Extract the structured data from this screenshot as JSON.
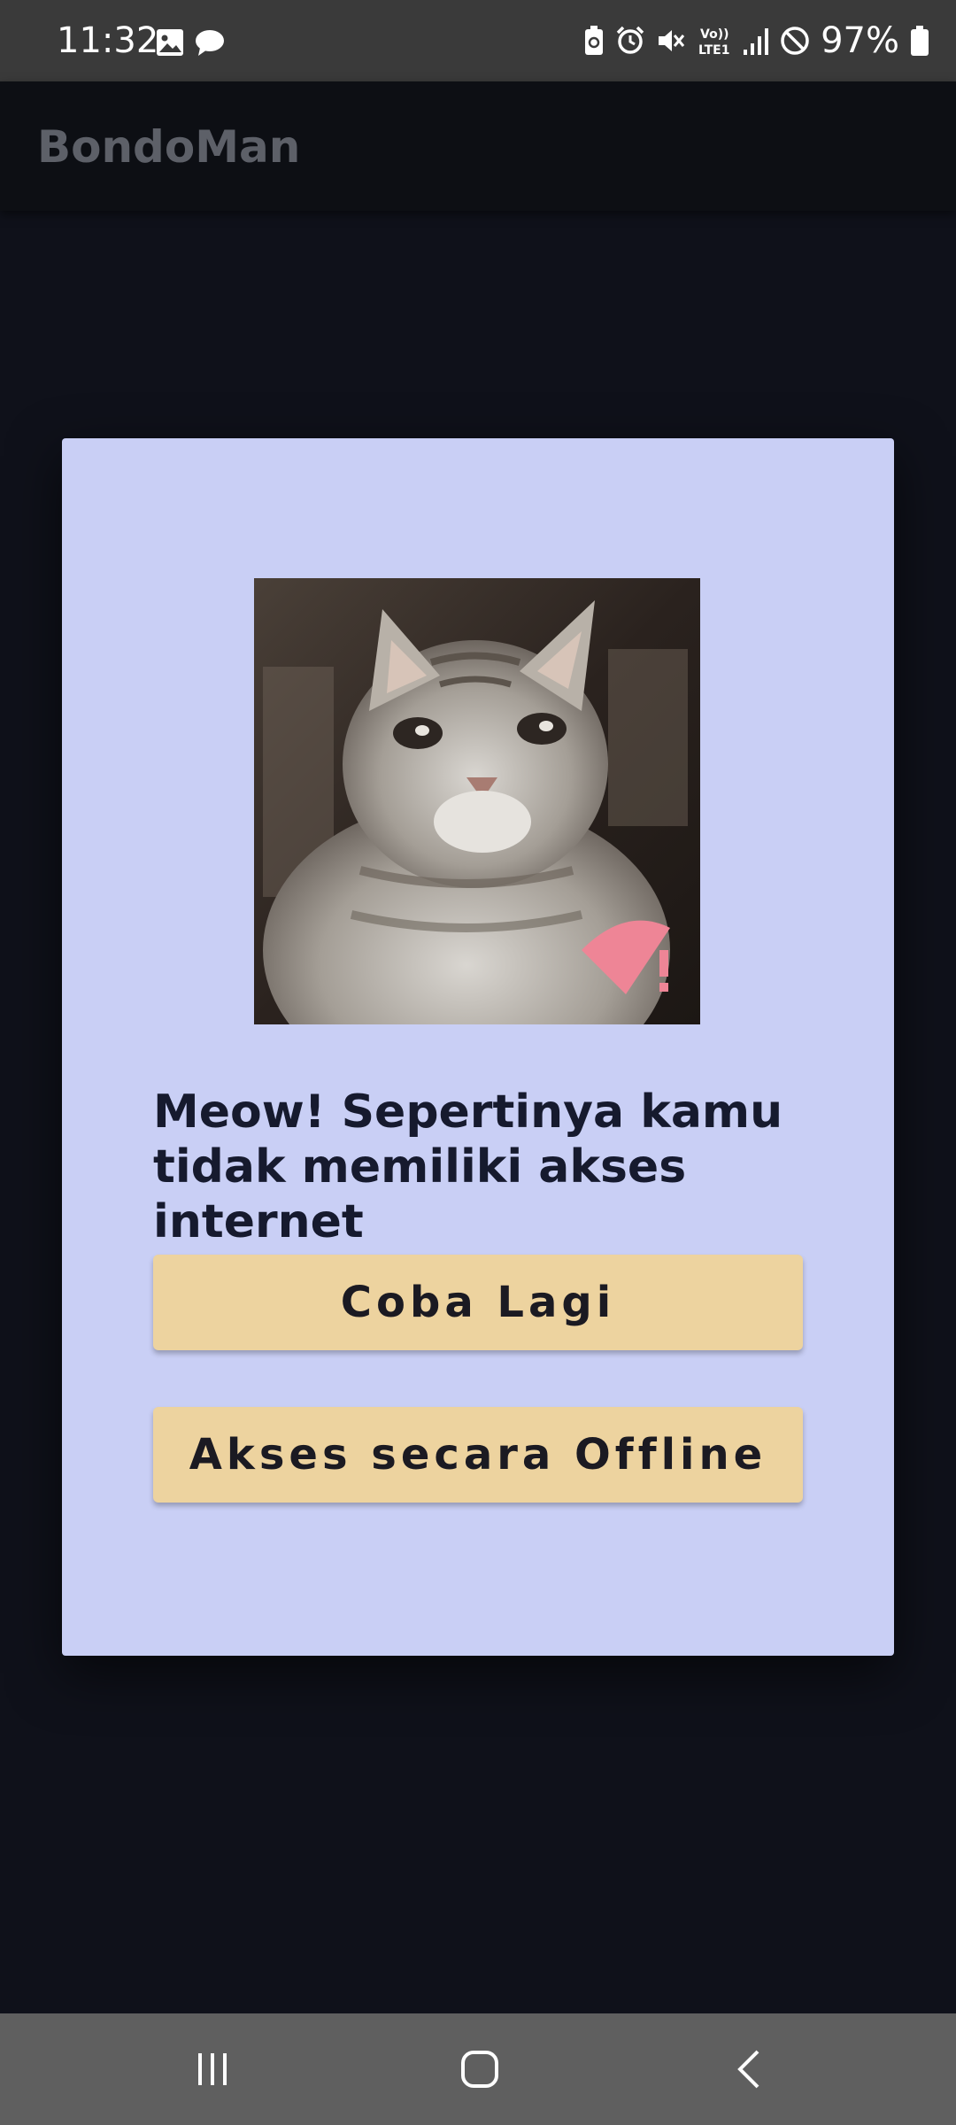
{
  "status_bar": {
    "time": "11:32",
    "battery_percent": "97%",
    "left_icons": [
      "image-icon",
      "chat-bubble-icon"
    ],
    "right_icons": [
      "battery-saver-icon",
      "alarm-icon",
      "mute-icon",
      "volte-icon",
      "signal-icon",
      "do-not-disturb-icon",
      "battery-icon"
    ],
    "volte_label": "Vo)) LTE1"
  },
  "app_bar": {
    "title": "BondoMan"
  },
  "dialog": {
    "image_icon": "cat-with-no-wifi-badge",
    "message": "Meow! Sepertinya kamu tidak memiliki akses internet",
    "retry_label": "Coba Lagi",
    "offline_label": "Akses secara Offline"
  },
  "colors": {
    "background": "#0f111a",
    "card": "#c9cff5",
    "button": "#edd39f",
    "wifi_badge": "#ee8596"
  },
  "nav_bar": {
    "icons": [
      "recent-apps-icon",
      "home-icon",
      "back-icon"
    ]
  }
}
